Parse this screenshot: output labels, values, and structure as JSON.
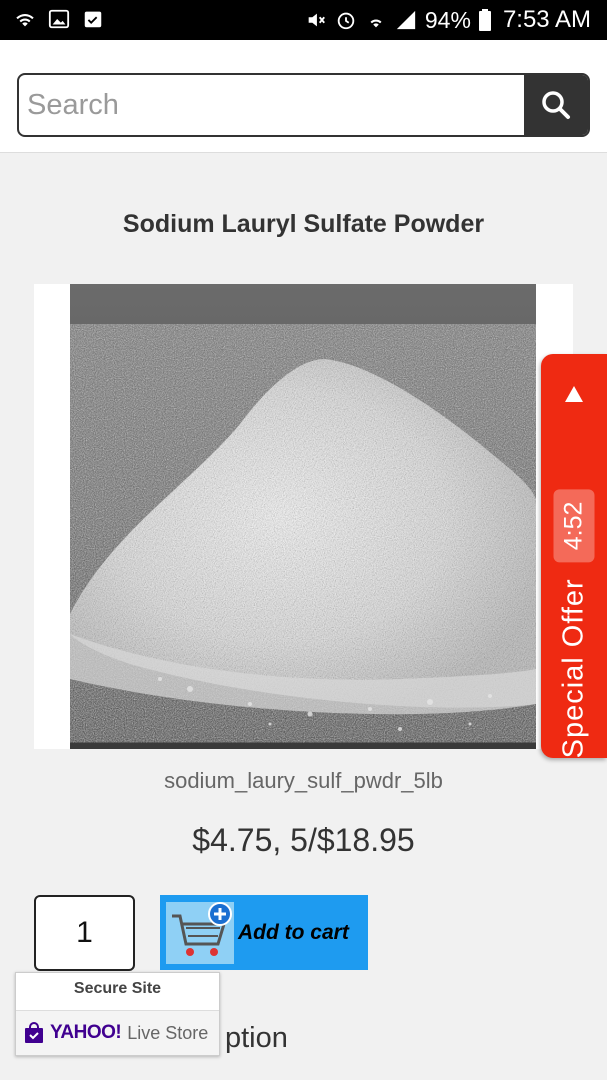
{
  "status_bar": {
    "battery": "94%",
    "time": "7:53 AM"
  },
  "search": {
    "placeholder": "Search",
    "value": ""
  },
  "product": {
    "title": "Sodium Lauryl Sulfate Powder",
    "sku": "sodium_laury_sulf_pwdr_5lb",
    "price": "$4.75, 5/$18.95",
    "quantity": "1",
    "add_to_cart_label": "Add to cart",
    "description_fragment": "ption"
  },
  "badge": {
    "title": "Secure Site",
    "brand": "YAHOO!",
    "store": "Live Store"
  },
  "special_offer": {
    "label": "Special Offer",
    "timer": "4:52"
  },
  "colors": {
    "cart_button": "#1e9bf0",
    "offer_tab": "#ef2a12",
    "search_button": "#333333"
  }
}
